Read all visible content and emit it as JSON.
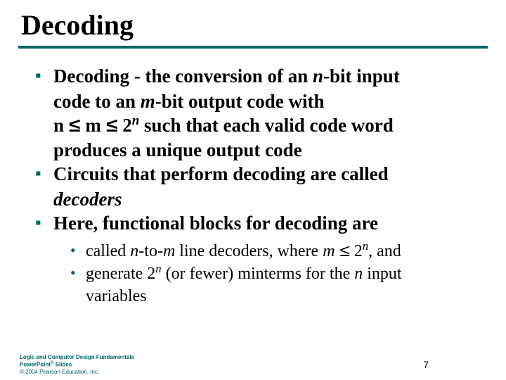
{
  "title": "Decoding",
  "bullets": {
    "b1_a": "Decoding",
    "b1_b": "- the conversion of an ",
    "b1_c": "-bit input",
    "b1_d": "code to an ",
    "b1_e": "-bit output code with",
    "b1_f": "n ",
    "b1_g": " m ",
    "b1_h": " 2",
    "b1_i": " such that each valid code word",
    "b1_j": "produces a unique output code",
    "b2_a": "Circuits that perform decoding are called",
    "b2_b": "decoders",
    "b3_a": "Here, functional blocks for decoding are"
  },
  "sub": {
    "s1_a": " called ",
    "s1_b": "-to-",
    "s1_c": " line decoders, where ",
    "s1_d": " 2",
    "s1_e": ", and",
    "s2_a": " generate 2",
    "s2_b": " (or fewer) minterms for the ",
    "s2_c": " input",
    "s2_d": "variables"
  },
  "vars": {
    "n": "n",
    "m": "m",
    "leq": "≤"
  },
  "footer": {
    "line1": "Logic and Computer Design Fundamentals",
    "line2a": "PowerPoint",
    "line2b": " Slides",
    "line3": "© 2004 Pearson Education, Inc."
  },
  "page": "7"
}
